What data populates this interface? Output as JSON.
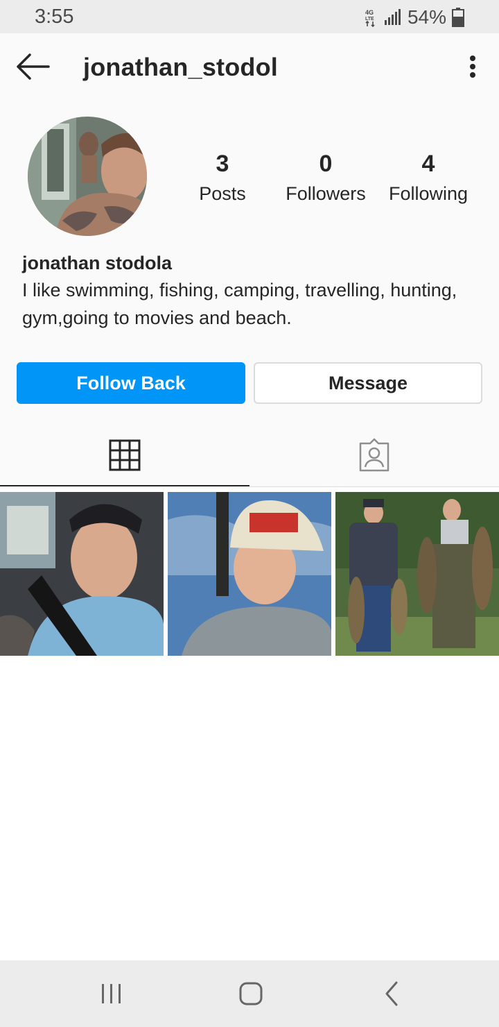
{
  "status_bar": {
    "time": "3:55",
    "network": "4G LTE",
    "battery": "54%",
    "icons": [
      "network-4g-icon",
      "signal-icon",
      "battery-icon"
    ]
  },
  "header": {
    "username": "jonathan_stodol",
    "icons": [
      "back-arrow-icon",
      "more-options-icon"
    ]
  },
  "profile": {
    "stats": [
      {
        "count": "3",
        "label": "Posts"
      },
      {
        "count": "0",
        "label": "Followers"
      },
      {
        "count": "4",
        "label": "Following"
      }
    ],
    "full_name": "jonathan stodola",
    "bio": "I like swimming, fishing, camping, travelling, hunting, gym,going to movies and beach."
  },
  "actions": {
    "follow_back": "Follow Back",
    "message": "Message"
  },
  "tabs": [
    {
      "icon": "grid-icon",
      "selected": true
    },
    {
      "icon": "tagged-person-icon",
      "selected": false
    }
  ],
  "posts": [
    {
      "description": "selfie-in-car"
    },
    {
      "description": "selfie-hard-hat"
    },
    {
      "description": "two-men-holding-fish"
    }
  ],
  "nav_bar": {
    "icons": [
      "recent-apps-icon",
      "home-icon",
      "back-icon"
    ]
  },
  "colors": {
    "accent": "#0095f6",
    "text": "#262626",
    "border": "#dbdbdb",
    "background": "#fafafa",
    "system_bar": "#ececec"
  }
}
